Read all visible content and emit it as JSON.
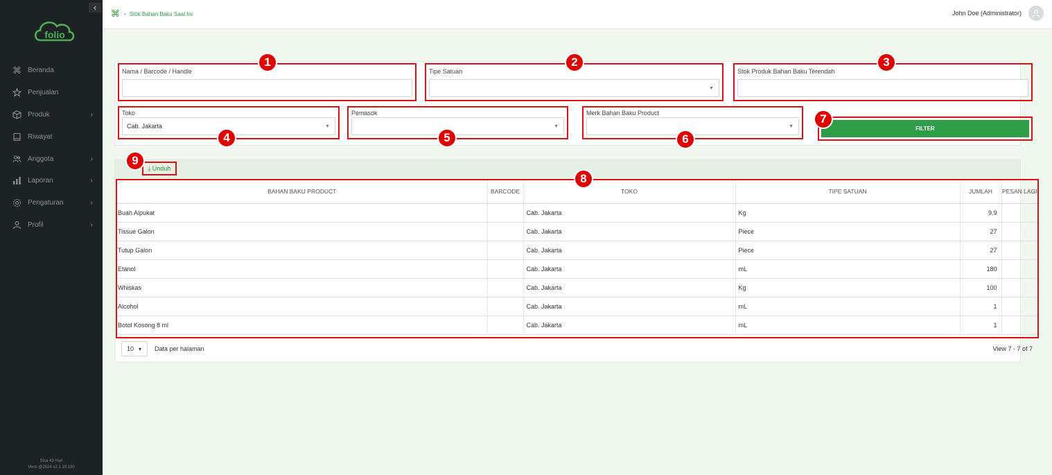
{
  "sidebar": {
    "collapse_glyph": "‹",
    "logo_text": "folio",
    "items": [
      {
        "label": "Beranda",
        "icon": "command-icon",
        "has_children": false
      },
      {
        "label": "Penjualan",
        "icon": "star-icon",
        "has_children": false
      },
      {
        "label": "Produk",
        "icon": "box-icon",
        "has_children": true
      },
      {
        "label": "Riwayat",
        "icon": "book-icon",
        "has_children": false
      },
      {
        "label": "Anggota",
        "icon": "users-icon",
        "has_children": true
      },
      {
        "label": "Laporan",
        "icon": "bar-chart-icon",
        "has_children": true
      },
      {
        "label": "Pengaturan",
        "icon": "gear-icon",
        "has_children": true
      },
      {
        "label": "Profil",
        "icon": "user-icon",
        "has_children": true
      }
    ],
    "footer_line1": "Sisa 43 Hari",
    "footer_line2": "Versi @2024 v2.1.19.130"
  },
  "header": {
    "breadcrumb_glyph": "⌘",
    "breadcrumb_sep": "•",
    "breadcrumb": "Stok Bahan Baku Saat Ini",
    "user": "John Doe (Administrator)"
  },
  "filters": {
    "name_label": "Nama / Barcode / Handle",
    "name_value": "",
    "unit_label": "Tipe Satuan",
    "unit_value": "",
    "lowest_label": "Stok Produk Bahan Baku Terendah",
    "lowest_value": "",
    "store_label": "Toko",
    "store_value": "Cab. Jakarta",
    "supplier_label": "Pemasok",
    "supplier_value": "",
    "brand_label": "Merk Bahan Baku Product",
    "brand_value": "",
    "filter_button": "FILTER"
  },
  "markers": [
    "1",
    "2",
    "3",
    "4",
    "5",
    "6",
    "7",
    "8",
    "9"
  ],
  "download_label": "Unduh",
  "download_glyph": "⤓",
  "table": {
    "columns": [
      "BAHAN BAKU PRODUCT",
      "BARCODE",
      "TOKO",
      "TIPE SATUAN",
      "JUMLAH",
      "PESAN LAGI"
    ],
    "rows": [
      {
        "name": "Buah Alpukat",
        "barcode": "",
        "store": "Cab. Jakarta",
        "unit": "Kg",
        "qty": "9.9",
        "reorder": ""
      },
      {
        "name": "Tissue Galon",
        "barcode": "",
        "store": "Cab. Jakarta",
        "unit": "Piece",
        "qty": "27",
        "reorder": ""
      },
      {
        "name": "Tutup Galon",
        "barcode": "",
        "store": "Cab. Jakarta",
        "unit": "Piece",
        "qty": "27",
        "reorder": ""
      },
      {
        "name": "Etanol",
        "barcode": "",
        "store": "Cab. Jakarta",
        "unit": "mL",
        "qty": "180",
        "reorder": ""
      },
      {
        "name": "Whiskas",
        "barcode": "",
        "store": "Cab. Jakarta",
        "unit": "Kg",
        "qty": "100",
        "reorder": ""
      },
      {
        "name": "Alcohol",
        "barcode": "",
        "store": "Cab. Jakarta",
        "unit": "mL",
        "qty": "1",
        "reorder": ""
      },
      {
        "name": "Botol Kosong 8 ml",
        "barcode": "",
        "store": "Cab. Jakarta",
        "unit": "mL",
        "qty": "1",
        "reorder": ""
      }
    ]
  },
  "pager": {
    "per_page": "10",
    "per_page_label": "Data per halaman",
    "view_info": "View 7 - 7 of 7"
  },
  "colors": {
    "sidebar_bg": "#1d2225",
    "brand_green": "#2f9d48",
    "annotation_red": "#e00000"
  }
}
